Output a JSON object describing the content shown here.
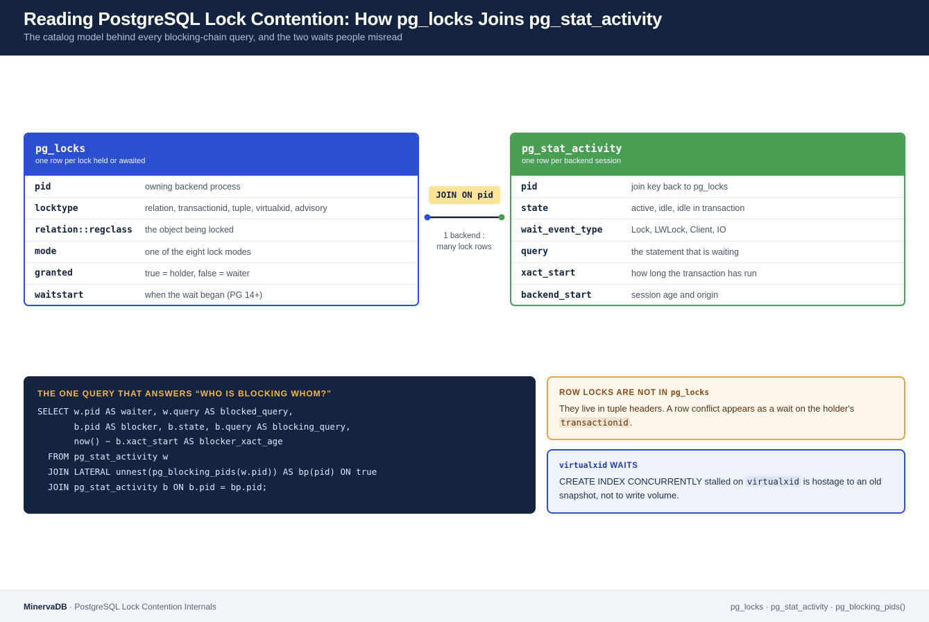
{
  "header": {
    "title": "Reading PostgreSQL Lock Contention: How pg_locks Joins pg_stat_activity",
    "subtitle": "The catalog model behind every blocking-chain query, and the two waits people misread"
  },
  "pg_locks": {
    "name": "pg_locks",
    "description": "one row per lock held or awaited",
    "fields": [
      {
        "name": "pid",
        "desc": "owning backend process"
      },
      {
        "name": "locktype",
        "desc": "relation, transactionid, tuple, virtualxid, advisory"
      },
      {
        "name": "relation::regclass",
        "desc": "the object being locked"
      },
      {
        "name": "mode",
        "desc": "one of the eight lock modes"
      },
      {
        "name": "granted",
        "desc": "true = holder, false = waiter"
      },
      {
        "name": "waitstart",
        "desc": "when the wait began (PG 14+)"
      }
    ]
  },
  "pg_stat_activity": {
    "name": "pg_stat_activity",
    "description": "one row per backend session",
    "fields": [
      {
        "name": "pid",
        "desc": "join key back to pg_locks"
      },
      {
        "name": "state",
        "desc": "active, idle, idle in transaction"
      },
      {
        "name": "wait_event_type",
        "desc": "Lock, LWLock, Client, IO"
      },
      {
        "name": "query",
        "desc": "the statement that is waiting"
      },
      {
        "name": "xact_start",
        "desc": "how long the transaction has run"
      },
      {
        "name": "backend_start",
        "desc": "session age and origin"
      }
    ]
  },
  "join": {
    "label": "JOIN ON pid",
    "cardinality_line1": "1 backend :",
    "cardinality_line2": "many lock rows"
  },
  "query_panel": {
    "title": "THE ONE QUERY THAT ANSWERS “WHO IS BLOCKING WHOM?”",
    "code": "SELECT w.pid AS waiter, w.query AS blocked_query,\n       b.pid AS blocker, b.state, b.query AS blocking_query,\n       now() − b.xact_start AS blocker_xact_age\n  FROM pg_stat_activity w\n  JOIN LATERAL unnest(pg_blocking_pids(w.pid)) AS bp(pid) ON true\n  JOIN pg_stat_activity b ON b.pid = bp.pid;"
  },
  "callout_row_locks": {
    "title_prefix": "ROW LOCKS ARE NOT IN ",
    "title_code": "pg_locks",
    "body_before": "They live in tuple headers. A row conflict appears as a wait on the holder's ",
    "body_code": "transactionid",
    "body_after": "."
  },
  "callout_virtualxid": {
    "title_code": "virtualxid",
    "title_suffix": " WAITS",
    "body_before": "CREATE INDEX CONCURRENTLY stalled on ",
    "body_code": "virtualxid",
    "body_after": " is hostage to an old snapshot, not to write volume."
  },
  "footer": {
    "brand": "MinervaDB",
    "left_text": " · PostgreSQL Lock Contention Internals",
    "right_text": "pg_locks · pg_stat_activity · pg_blocking_pids()"
  },
  "colors": {
    "navy": "#14233f",
    "locks_blue": "#2c4fd1",
    "activity_green": "#4a9e53",
    "join_yellow": "#fbe39a",
    "amber": "#e6a637"
  }
}
